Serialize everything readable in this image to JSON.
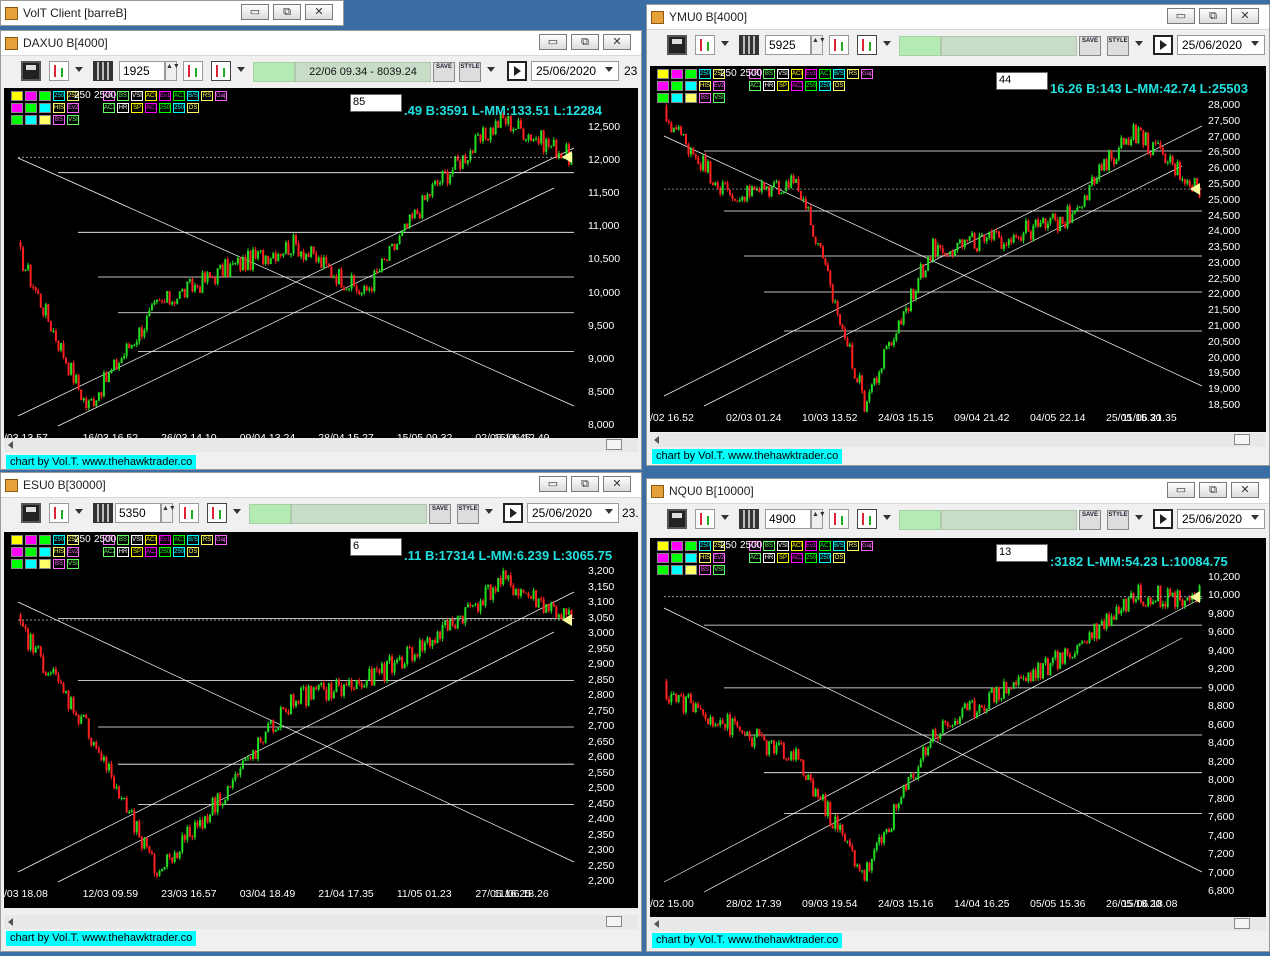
{
  "app": {
    "title": "VolT Client [barreB]",
    "buttons": {
      "minimize": "▭",
      "restore": "⧉",
      "close": "✕"
    }
  },
  "credit": "chart by Vol.T. www.thehawktrader.co",
  "indicator_labels": [
    "250",
    "2500",
    "OS",
    "BS",
    "VSI",
    "ACI",
    "Ev1",
    "AC1",
    "B/S",
    "RS",
    "Gap",
    "HIST",
    "Ev2",
    "AC2",
    "HR",
    "SP",
    "AC3"
  ],
  "windows": [
    {
      "id": "dax",
      "title": "DAXU0 B[4000]",
      "count": "1925",
      "status_text": "22/06 09.34 - 8039.24",
      "date": "25/06/2020",
      "date_tail": "23",
      "input_value": "85",
      "info": ".49 B:3591 L-MM:133.51 L:12284",
      "y_labels": [
        "12,500",
        "12,000",
        "11,500",
        "11,000",
        "10,500",
        "10,000",
        "9,500",
        "9,000",
        "8,500",
        "8,000"
      ],
      "x_labels": [
        "/03 13.57",
        "16/03 16.52",
        "26/03 14.10",
        "09/04 13.24",
        "28/04 15.27",
        "15/05 09.32",
        "02/06 14.45",
        "15/06 12.49"
      ]
    },
    {
      "id": "ym",
      "title": "YMU0 B[4000]",
      "count": "5925",
      "status_text": "",
      "date": "25/06/2020",
      "date_tail": "",
      "input_value": "44",
      "info": "16.26 B:143 L-MM:42.74 L:25503",
      "y_labels": [
        "28,000",
        "27,500",
        "27,000",
        "26,500",
        "26,000",
        "25,500",
        "25,000",
        "24,500",
        "24,000",
        "23,500",
        "23,000",
        "22,500",
        "22,000",
        "21,500",
        "21,000",
        "20,500",
        "20,000",
        "19,500",
        "19,000",
        "18,500"
      ],
      "x_labels": [
        "/02 16.52",
        "02/03 01.24",
        "10/03 13.52",
        "24/03 15.15",
        "09/04 21.42",
        "04/05 22.14",
        "25/05 15.30",
        "11/06 21.35"
      ]
    },
    {
      "id": "es",
      "title": "ESU0 B[30000]",
      "count": "5350",
      "status_text": "",
      "date": "25/06/2020",
      "date_tail": "23.",
      "input_value": "6",
      "info": ".11 B:17314 L-MM:6.239 L:3065.75",
      "y_labels": [
        "3,200",
        "3,150",
        "3,100",
        "3,050",
        "3,000",
        "2,950",
        "2,900",
        "2,850",
        "2,800",
        "2,750",
        "2,700",
        "2,650",
        "2,600",
        "2,550",
        "2,500",
        "2,450",
        "2,400",
        "2,350",
        "2,300",
        "2,250",
        "2,200"
      ],
      "x_labels": [
        "/03 18.08",
        "12/03 09.59",
        "23/03 16.57",
        "03/04 18.49",
        "21/04 17.35",
        "11/05 01.23",
        "27/05 16.25",
        "11/06 18.26"
      ]
    },
    {
      "id": "nq",
      "title": "NQU0 B[10000]",
      "count": "4900",
      "status_text": "",
      "date": "25/06/2020",
      "date_tail": "",
      "input_value": "13",
      "info": ":3182 L-MM:54.23 L:10084.75",
      "y_labels": [
        "10,200",
        "10,000",
        "9,800",
        "9,600",
        "9,400",
        "9,200",
        "9,000",
        "8,800",
        "8,600",
        "8,400",
        "8,200",
        "8,000",
        "7,800",
        "7,600",
        "7,400",
        "7,200",
        "7,000",
        "6,800"
      ],
      "x_labels": [
        "/02 15.00",
        "28/02 17.39",
        "09/03 19.54",
        "24/03 15.16",
        "14/04 16.25",
        "05/05 15.36",
        "26/05 18.20",
        "15/06 18.08"
      ]
    }
  ],
  "chart_data": [
    {
      "type": "candlestick",
      "title": "DAXU0 B[4000]",
      "ylim": [
        8000,
        12750
      ],
      "x": [
        "/03 13.57",
        "16/03 16.52",
        "26/03 14.10",
        "09/04 13.24",
        "28/04 15.27",
        "15/05 09.32",
        "02/06 14.45",
        "15/06 12.49",
        "25/06"
      ],
      "y": [
        10800,
        8300,
        9900,
        10500,
        10900,
        10100,
        11800,
        12900,
        12284
      ]
    },
    {
      "type": "candlestick",
      "title": "YMU0 B[4000]",
      "ylim": [
        18200,
        28300
      ],
      "x": [
        "/02 16.52",
        "02/03 01.24",
        "10/03 13.52",
        "24/03 15.15",
        "09/04 21.42",
        "04/05 22.14",
        "25/05 15.30",
        "11/06 21.35",
        "25/06"
      ],
      "y": [
        28000,
        25200,
        25800,
        18300,
        23500,
        23800,
        24500,
        27500,
        25503
      ]
    },
    {
      "type": "candlestick",
      "title": "ESU0 B[30000]",
      "ylim": [
        2170,
        3230
      ],
      "x": [
        "/03 18.08",
        "12/03 09.59",
        "23/03 16.57",
        "03/04 18.49",
        "21/04 17.35",
        "11/05 01.23",
        "27/05 16.25",
        "11/06 18.26",
        "25/06"
      ],
      "y": [
        3050,
        2700,
        2200,
        2480,
        2800,
        2850,
        3000,
        3200,
        3065.75
      ]
    },
    {
      "type": "candlestick",
      "title": "NQU0 B[10000]",
      "ylim": [
        6700,
        10300
      ],
      "x": [
        "/02 15.00",
        "28/02 17.39",
        "09/03 19.54",
        "24/03 15.16",
        "14/04 16.25",
        "05/05 15.36",
        "26/05 18.20",
        "15/06 18.08",
        "25/06"
      ],
      "y": [
        9000,
        8600,
        8200,
        6900,
        8500,
        9000,
        9400,
        10100,
        10084.75
      ]
    }
  ]
}
